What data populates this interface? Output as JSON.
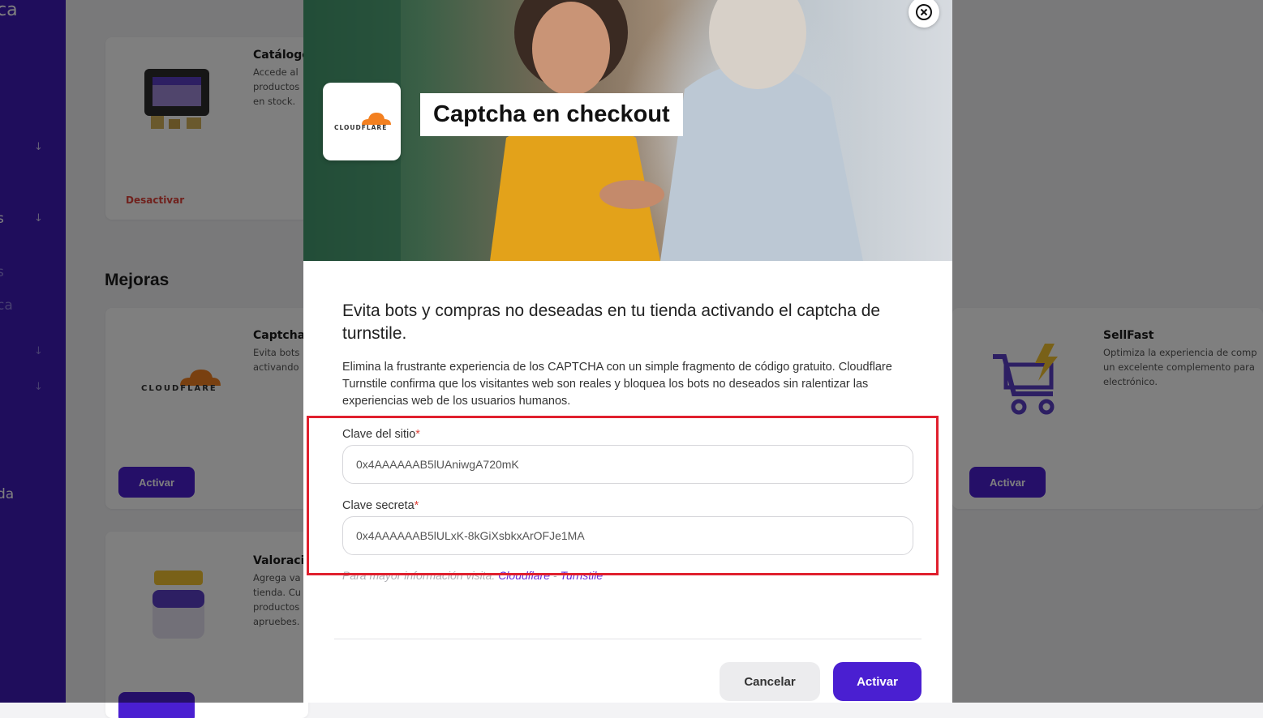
{
  "sidebar": {
    "fragments": [
      "ca",
      "s",
      "s",
      "ca",
      "da"
    ]
  },
  "background": {
    "section_title": "Mejoras",
    "cards": [
      {
        "title": "Catálogo",
        "desc": [
          "Accede al",
          "productos",
          "en stock."
        ],
        "action": "Desactivar"
      },
      {
        "title": "Captcha",
        "desc": [
          "Evita bots",
          "activando"
        ],
        "logo_text": "CLOUDFLARE",
        "action": "Activar"
      },
      {
        "title": "SellFast",
        "desc": [
          "Optimiza la experiencia de comp",
          "un excelente complemento para",
          "electrónico."
        ],
        "action": "Activar"
      },
      {
        "title": "Valoraci",
        "desc": [
          "Agrega va",
          "tienda. Cu",
          "productos",
          "apruebes."
        ],
        "action": ""
      }
    ]
  },
  "modal": {
    "logo_text": "CLOUDFLARE",
    "title": "Captcha en checkout",
    "heading": "Evita bots y compras no deseadas en tu tienda activando el captcha de turnstile.",
    "description": "Elimina la frustrante experiencia de los CAPTCHA con un simple fragmento de código gratuito. Cloudflare Turnstile confirma que los visitantes web son reales y bloquea los bots no deseados sin ralentizar las experiencias web de los usuarios humanos.",
    "fields": [
      {
        "label": "Clave del sitio",
        "required_mark": "*",
        "value": "0x4AAAAAAB5lUAniwgA720mK"
      },
      {
        "label": "Clave secreta",
        "required_mark": "*",
        "value": "0x4AAAAAAB5lULxK-8kGiXsbkxArOFJe1MA"
      }
    ],
    "info_prefix": "Para mayor información visita:",
    "info_links": [
      "Cloudflare",
      "Turnstile"
    ],
    "info_separator": "-",
    "cancel_label": "Cancelar",
    "activate_label": "Activar"
  },
  "colors": {
    "sidebar": "#3f1bb8",
    "accent": "#4a1fd1",
    "danger": "#e0433a",
    "highlight": "#e0202e"
  }
}
